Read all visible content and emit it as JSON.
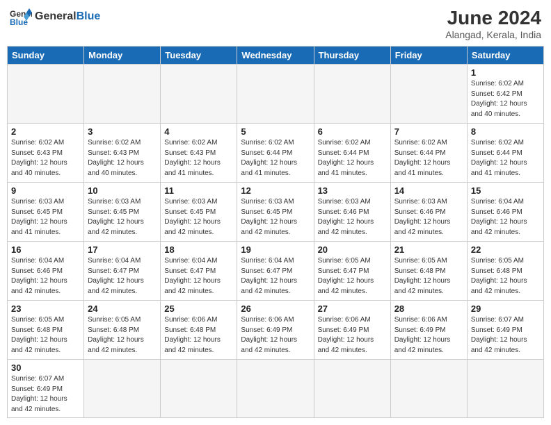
{
  "header": {
    "logo_general": "General",
    "logo_blue": "Blue",
    "month_year": "June 2024",
    "location": "Alangad, Kerala, India"
  },
  "weekdays": [
    "Sunday",
    "Monday",
    "Tuesday",
    "Wednesday",
    "Thursday",
    "Friday",
    "Saturday"
  ],
  "weeks": [
    [
      {
        "day": "",
        "info": ""
      },
      {
        "day": "",
        "info": ""
      },
      {
        "day": "",
        "info": ""
      },
      {
        "day": "",
        "info": ""
      },
      {
        "day": "",
        "info": ""
      },
      {
        "day": "",
        "info": ""
      },
      {
        "day": "1",
        "info": "Sunrise: 6:02 AM\nSunset: 6:42 PM\nDaylight: 12 hours\nand 40 minutes."
      }
    ],
    [
      {
        "day": "2",
        "info": "Sunrise: 6:02 AM\nSunset: 6:43 PM\nDaylight: 12 hours\nand 40 minutes."
      },
      {
        "day": "3",
        "info": "Sunrise: 6:02 AM\nSunset: 6:43 PM\nDaylight: 12 hours\nand 40 minutes."
      },
      {
        "day": "4",
        "info": "Sunrise: 6:02 AM\nSunset: 6:43 PM\nDaylight: 12 hours\nand 41 minutes."
      },
      {
        "day": "5",
        "info": "Sunrise: 6:02 AM\nSunset: 6:44 PM\nDaylight: 12 hours\nand 41 minutes."
      },
      {
        "day": "6",
        "info": "Sunrise: 6:02 AM\nSunset: 6:44 PM\nDaylight: 12 hours\nand 41 minutes."
      },
      {
        "day": "7",
        "info": "Sunrise: 6:02 AM\nSunset: 6:44 PM\nDaylight: 12 hours\nand 41 minutes."
      },
      {
        "day": "8",
        "info": "Sunrise: 6:02 AM\nSunset: 6:44 PM\nDaylight: 12 hours\nand 41 minutes."
      }
    ],
    [
      {
        "day": "9",
        "info": "Sunrise: 6:03 AM\nSunset: 6:45 PM\nDaylight: 12 hours\nand 41 minutes."
      },
      {
        "day": "10",
        "info": "Sunrise: 6:03 AM\nSunset: 6:45 PM\nDaylight: 12 hours\nand 42 minutes."
      },
      {
        "day": "11",
        "info": "Sunrise: 6:03 AM\nSunset: 6:45 PM\nDaylight: 12 hours\nand 42 minutes."
      },
      {
        "day": "12",
        "info": "Sunrise: 6:03 AM\nSunset: 6:45 PM\nDaylight: 12 hours\nand 42 minutes."
      },
      {
        "day": "13",
        "info": "Sunrise: 6:03 AM\nSunset: 6:46 PM\nDaylight: 12 hours\nand 42 minutes."
      },
      {
        "day": "14",
        "info": "Sunrise: 6:03 AM\nSunset: 6:46 PM\nDaylight: 12 hours\nand 42 minutes."
      },
      {
        "day": "15",
        "info": "Sunrise: 6:04 AM\nSunset: 6:46 PM\nDaylight: 12 hours\nand 42 minutes."
      }
    ],
    [
      {
        "day": "16",
        "info": "Sunrise: 6:04 AM\nSunset: 6:46 PM\nDaylight: 12 hours\nand 42 minutes."
      },
      {
        "day": "17",
        "info": "Sunrise: 6:04 AM\nSunset: 6:47 PM\nDaylight: 12 hours\nand 42 minutes."
      },
      {
        "day": "18",
        "info": "Sunrise: 6:04 AM\nSunset: 6:47 PM\nDaylight: 12 hours\nand 42 minutes."
      },
      {
        "day": "19",
        "info": "Sunrise: 6:04 AM\nSunset: 6:47 PM\nDaylight: 12 hours\nand 42 minutes."
      },
      {
        "day": "20",
        "info": "Sunrise: 6:05 AM\nSunset: 6:47 PM\nDaylight: 12 hours\nand 42 minutes."
      },
      {
        "day": "21",
        "info": "Sunrise: 6:05 AM\nSunset: 6:48 PM\nDaylight: 12 hours\nand 42 minutes."
      },
      {
        "day": "22",
        "info": "Sunrise: 6:05 AM\nSunset: 6:48 PM\nDaylight: 12 hours\nand 42 minutes."
      }
    ],
    [
      {
        "day": "23",
        "info": "Sunrise: 6:05 AM\nSunset: 6:48 PM\nDaylight: 12 hours\nand 42 minutes."
      },
      {
        "day": "24",
        "info": "Sunrise: 6:05 AM\nSunset: 6:48 PM\nDaylight: 12 hours\nand 42 minutes."
      },
      {
        "day": "25",
        "info": "Sunrise: 6:06 AM\nSunset: 6:48 PM\nDaylight: 12 hours\nand 42 minutes."
      },
      {
        "day": "26",
        "info": "Sunrise: 6:06 AM\nSunset: 6:49 PM\nDaylight: 12 hours\nand 42 minutes."
      },
      {
        "day": "27",
        "info": "Sunrise: 6:06 AM\nSunset: 6:49 PM\nDaylight: 12 hours\nand 42 minutes."
      },
      {
        "day": "28",
        "info": "Sunrise: 6:06 AM\nSunset: 6:49 PM\nDaylight: 12 hours\nand 42 minutes."
      },
      {
        "day": "29",
        "info": "Sunrise: 6:07 AM\nSunset: 6:49 PM\nDaylight: 12 hours\nand 42 minutes."
      }
    ],
    [
      {
        "day": "30",
        "info": "Sunrise: 6:07 AM\nSunset: 6:49 PM\nDaylight: 12 hours\nand 42 minutes."
      },
      {
        "day": "",
        "info": ""
      },
      {
        "day": "",
        "info": ""
      },
      {
        "day": "",
        "info": ""
      },
      {
        "day": "",
        "info": ""
      },
      {
        "day": "",
        "info": ""
      },
      {
        "day": "",
        "info": ""
      }
    ]
  ]
}
